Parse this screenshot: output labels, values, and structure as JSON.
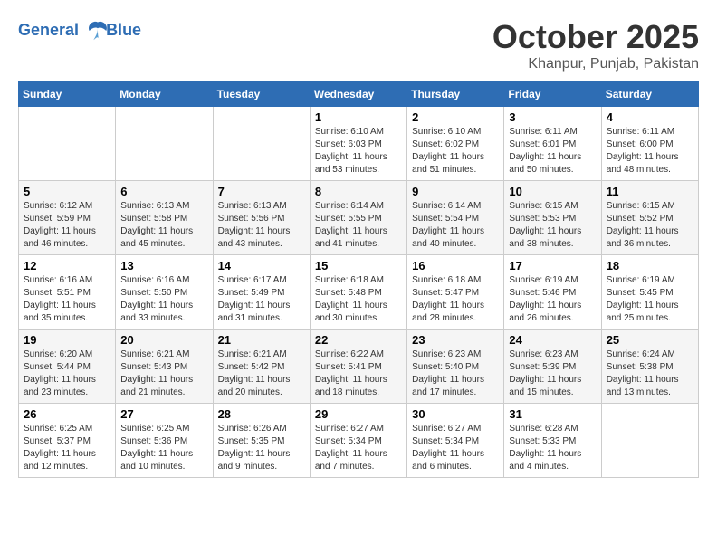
{
  "header": {
    "logo_line1": "General",
    "logo_line2": "Blue",
    "month": "October 2025",
    "location": "Khanpur, Punjab, Pakistan"
  },
  "weekdays": [
    "Sunday",
    "Monday",
    "Tuesday",
    "Wednesday",
    "Thursday",
    "Friday",
    "Saturday"
  ],
  "weeks": [
    [
      {
        "day": "",
        "info": ""
      },
      {
        "day": "",
        "info": ""
      },
      {
        "day": "",
        "info": ""
      },
      {
        "day": "1",
        "info": "Sunrise: 6:10 AM\nSunset: 6:03 PM\nDaylight: 11 hours\nand 53 minutes."
      },
      {
        "day": "2",
        "info": "Sunrise: 6:10 AM\nSunset: 6:02 PM\nDaylight: 11 hours\nand 51 minutes."
      },
      {
        "day": "3",
        "info": "Sunrise: 6:11 AM\nSunset: 6:01 PM\nDaylight: 11 hours\nand 50 minutes."
      },
      {
        "day": "4",
        "info": "Sunrise: 6:11 AM\nSunset: 6:00 PM\nDaylight: 11 hours\nand 48 minutes."
      }
    ],
    [
      {
        "day": "5",
        "info": "Sunrise: 6:12 AM\nSunset: 5:59 PM\nDaylight: 11 hours\nand 46 minutes."
      },
      {
        "day": "6",
        "info": "Sunrise: 6:13 AM\nSunset: 5:58 PM\nDaylight: 11 hours\nand 45 minutes."
      },
      {
        "day": "7",
        "info": "Sunrise: 6:13 AM\nSunset: 5:56 PM\nDaylight: 11 hours\nand 43 minutes."
      },
      {
        "day": "8",
        "info": "Sunrise: 6:14 AM\nSunset: 5:55 PM\nDaylight: 11 hours\nand 41 minutes."
      },
      {
        "day": "9",
        "info": "Sunrise: 6:14 AM\nSunset: 5:54 PM\nDaylight: 11 hours\nand 40 minutes."
      },
      {
        "day": "10",
        "info": "Sunrise: 6:15 AM\nSunset: 5:53 PM\nDaylight: 11 hours\nand 38 minutes."
      },
      {
        "day": "11",
        "info": "Sunrise: 6:15 AM\nSunset: 5:52 PM\nDaylight: 11 hours\nand 36 minutes."
      }
    ],
    [
      {
        "day": "12",
        "info": "Sunrise: 6:16 AM\nSunset: 5:51 PM\nDaylight: 11 hours\nand 35 minutes."
      },
      {
        "day": "13",
        "info": "Sunrise: 6:16 AM\nSunset: 5:50 PM\nDaylight: 11 hours\nand 33 minutes."
      },
      {
        "day": "14",
        "info": "Sunrise: 6:17 AM\nSunset: 5:49 PM\nDaylight: 11 hours\nand 31 minutes."
      },
      {
        "day": "15",
        "info": "Sunrise: 6:18 AM\nSunset: 5:48 PM\nDaylight: 11 hours\nand 30 minutes."
      },
      {
        "day": "16",
        "info": "Sunrise: 6:18 AM\nSunset: 5:47 PM\nDaylight: 11 hours\nand 28 minutes."
      },
      {
        "day": "17",
        "info": "Sunrise: 6:19 AM\nSunset: 5:46 PM\nDaylight: 11 hours\nand 26 minutes."
      },
      {
        "day": "18",
        "info": "Sunrise: 6:19 AM\nSunset: 5:45 PM\nDaylight: 11 hours\nand 25 minutes."
      }
    ],
    [
      {
        "day": "19",
        "info": "Sunrise: 6:20 AM\nSunset: 5:44 PM\nDaylight: 11 hours\nand 23 minutes."
      },
      {
        "day": "20",
        "info": "Sunrise: 6:21 AM\nSunset: 5:43 PM\nDaylight: 11 hours\nand 21 minutes."
      },
      {
        "day": "21",
        "info": "Sunrise: 6:21 AM\nSunset: 5:42 PM\nDaylight: 11 hours\nand 20 minutes."
      },
      {
        "day": "22",
        "info": "Sunrise: 6:22 AM\nSunset: 5:41 PM\nDaylight: 11 hours\nand 18 minutes."
      },
      {
        "day": "23",
        "info": "Sunrise: 6:23 AM\nSunset: 5:40 PM\nDaylight: 11 hours\nand 17 minutes."
      },
      {
        "day": "24",
        "info": "Sunrise: 6:23 AM\nSunset: 5:39 PM\nDaylight: 11 hours\nand 15 minutes."
      },
      {
        "day": "25",
        "info": "Sunrise: 6:24 AM\nSunset: 5:38 PM\nDaylight: 11 hours\nand 13 minutes."
      }
    ],
    [
      {
        "day": "26",
        "info": "Sunrise: 6:25 AM\nSunset: 5:37 PM\nDaylight: 11 hours\nand 12 minutes."
      },
      {
        "day": "27",
        "info": "Sunrise: 6:25 AM\nSunset: 5:36 PM\nDaylight: 11 hours\nand 10 minutes."
      },
      {
        "day": "28",
        "info": "Sunrise: 6:26 AM\nSunset: 5:35 PM\nDaylight: 11 hours\nand 9 minutes."
      },
      {
        "day": "29",
        "info": "Sunrise: 6:27 AM\nSunset: 5:34 PM\nDaylight: 11 hours\nand 7 minutes."
      },
      {
        "day": "30",
        "info": "Sunrise: 6:27 AM\nSunset: 5:34 PM\nDaylight: 11 hours\nand 6 minutes."
      },
      {
        "day": "31",
        "info": "Sunrise: 6:28 AM\nSunset: 5:33 PM\nDaylight: 11 hours\nand 4 minutes."
      },
      {
        "day": "",
        "info": ""
      }
    ]
  ]
}
